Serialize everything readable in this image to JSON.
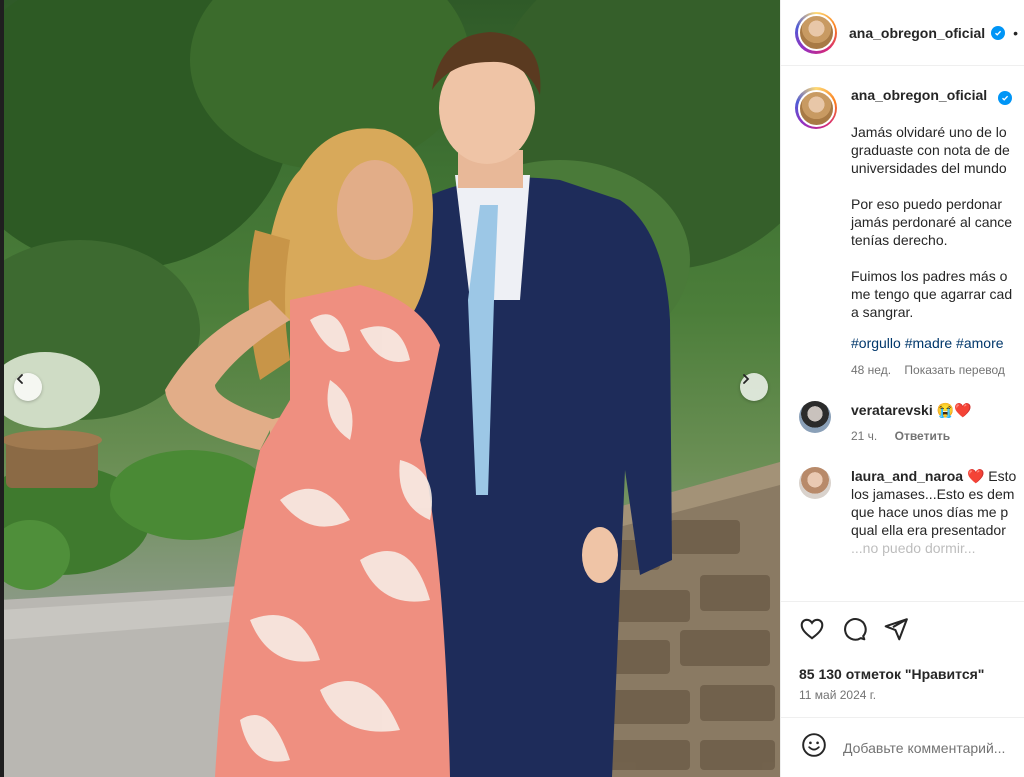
{
  "post": {
    "username": "ana_obregon_oficial",
    "header_separator": "•",
    "caption": {
      "paragraphs": [
        [
          "Jamás olvidaré uno de lo",
          "graduaste con nota de de",
          "universidades del mundo"
        ],
        [
          "Por eso puedo perdonar",
          "jamás perdonaré al cance",
          "tenías derecho."
        ],
        [
          "Fuimos los padres más o",
          "me tengo que agarrar cad",
          "a sangrar."
        ]
      ],
      "hashtags": "#orgullo #madre #amore",
      "time": "48 нед.",
      "translate_label": "Показать перевод"
    },
    "comments": [
      {
        "username": "veratarevski",
        "text": "😭❤️",
        "time": "21 ч.",
        "reply_label": "Ответить"
      },
      {
        "username": "laura_and_naroa",
        "text_lines": [
          "❤️ Esto",
          "los jamases...Esto es dem",
          "que hace unos días me p",
          "qual ella era presentador",
          "...no puedo dormir..."
        ]
      }
    ],
    "likes": "85 130 отметок \"Нравится\"",
    "date": "11 май 2024 г.",
    "add_comment_placeholder": "Добавьте комментарий..."
  },
  "icons": {
    "like": "heart-icon",
    "comment": "comment-icon",
    "share": "share-icon",
    "emoji": "emoji-icon",
    "verified": "verified-badge-icon",
    "prev": "chevron-left-icon",
    "next": "chevron-right-icon"
  },
  "colors": {
    "verified": "#0095f6",
    "link": "#00376b",
    "muted": "#737373",
    "text": "#262626"
  }
}
